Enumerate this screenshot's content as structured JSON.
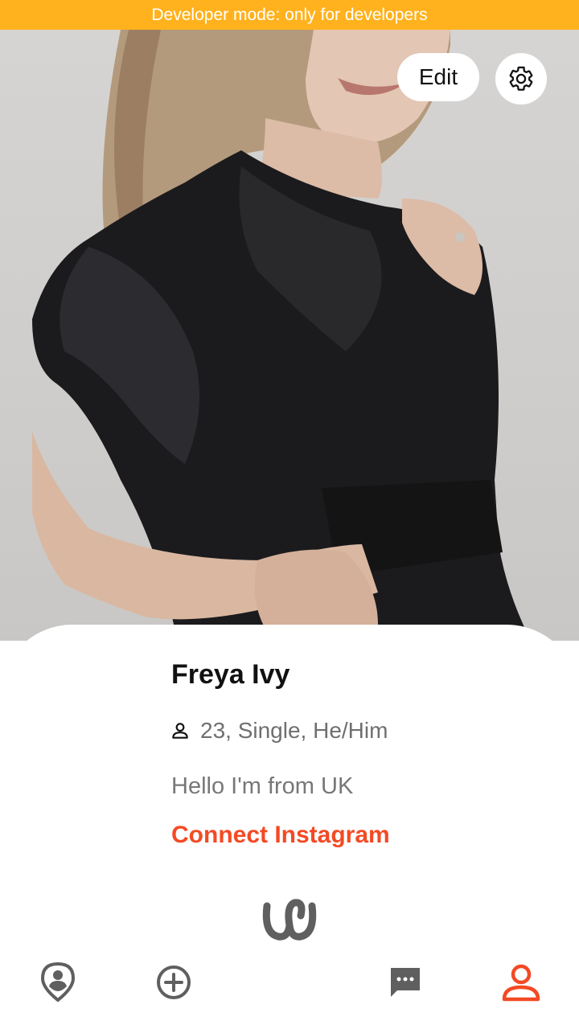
{
  "banner": {
    "text": "Developer mode: only for developers",
    "color": "#ffb21e"
  },
  "header": {
    "edit_label": "Edit",
    "settings_icon": "gear-icon"
  },
  "profile": {
    "name": "Freya Ivy",
    "details": "23, Single, He/Him",
    "bio": "Hello I'm from UK",
    "connect_label": "Connect Instagram",
    "accent_color": "#f34a24"
  },
  "nav": {
    "items": [
      {
        "icon": "location-pin-icon",
        "active": false
      },
      {
        "icon": "add-circle-icon",
        "active": false
      },
      {
        "icon": "chat-icon",
        "active": false
      },
      {
        "icon": "profile-icon",
        "active": true
      }
    ]
  }
}
